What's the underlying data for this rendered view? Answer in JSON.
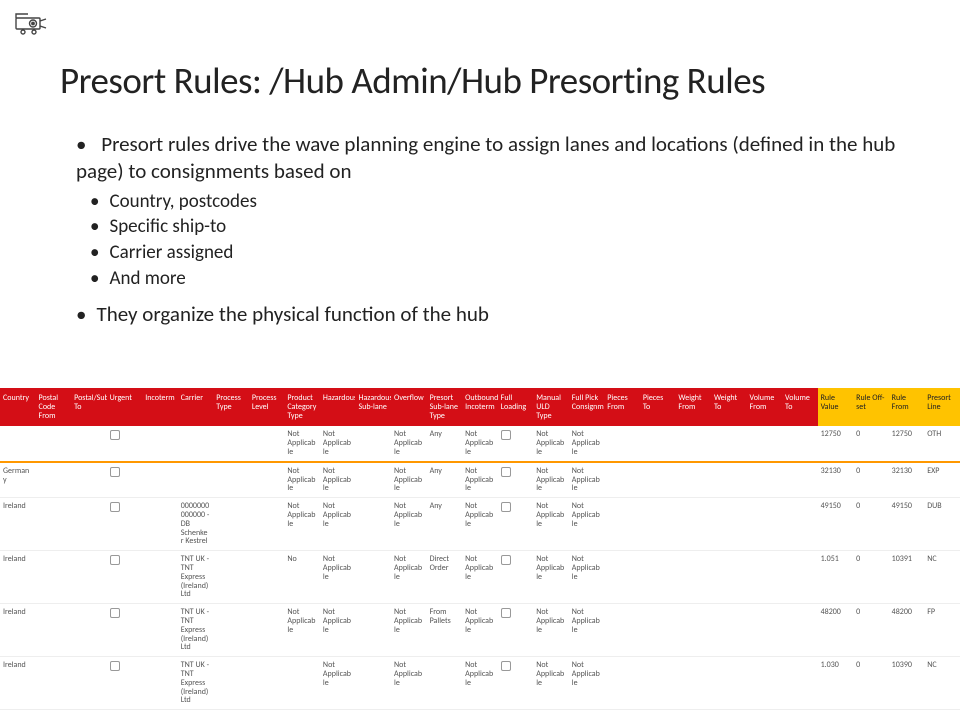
{
  "title": "Presort Rules: /Hub Admin/Hub Presorting Rules",
  "bullets": {
    "main1": "Presort rules drive the wave planning engine to assign lanes and locations (defined in the hub page) to consignments based on",
    "sub": [
      "Country, postcodes",
      "Specific ship-to",
      "Carrier assigned",
      "And more"
    ],
    "main2": "They organize the physical function of the hub"
  },
  "icon_name": "projector-icon",
  "table": {
    "headers": [
      "Country",
      "Postal Code From",
      "Postal/Sub To",
      "Urgent",
      "Incoterm",
      "Carrier",
      "Process Type",
      "Process Level",
      "Product Category Type",
      "Hazardous",
      "Hazardous Sub-lane",
      "Overflow",
      "Presort Sub-lane Type",
      "Outbound Incoterm",
      "Full Loading",
      "Manual ULD Type",
      "Full Pick Consignment",
      "Pieces From",
      "Pieces To",
      "Weight From",
      "Weight To",
      "Volume From",
      "Volume To",
      "Rule Value",
      "Rule Off-set",
      "Rule From",
      "Presort Line"
    ],
    "rows": [
      {
        "special": false,
        "cells": [
          "",
          "",
          "",
          "☐",
          "",
          "",
          "",
          "",
          "Not Applicable",
          "Not Applicable",
          "",
          "Not Applicable",
          "Any",
          "Not Applicable",
          "☐",
          "Not Applicable",
          "Not Applicable",
          "",
          "",
          "",
          "",
          "",
          "",
          "12750",
          "0",
          "12750",
          "OTH"
        ]
      },
      {
        "special": true,
        "cells": [
          "Germany",
          "",
          "",
          "☐",
          "",
          "",
          "",
          "",
          "Not Applicable",
          "Not Applicable",
          "",
          "Not Applicable",
          "Any",
          "Not Applicable",
          "☐",
          "Not Applicable",
          "Not Applicable",
          "",
          "",
          "",
          "",
          "",
          "",
          "32130",
          "0",
          "32130",
          "EXP"
        ]
      },
      {
        "special": false,
        "cells": [
          "Ireland",
          "",
          "",
          "☐",
          "",
          "0000000000000 - DB Schenker Kestrel",
          "",
          "",
          "Not Applicable",
          "Not Applicable",
          "",
          "Not Applicable",
          "Any",
          "Not Applicable",
          "☐",
          "Not Applicable",
          "Not Applicable",
          "",
          "",
          "",
          "",
          "",
          "",
          "49150",
          "0",
          "49150",
          "DUB"
        ]
      },
      {
        "special": false,
        "cells": [
          "Ireland",
          "",
          "",
          "☐",
          "",
          "TNT UK - TNT Express (Ireland) Ltd",
          "",
          "",
          "No",
          "Not Applicable",
          "",
          "Not Applicable",
          "Direct Order",
          "Not Applicable",
          "☐",
          "Not Applicable",
          "Not Applicable",
          "",
          "",
          "",
          "",
          "",
          "",
          "1.051",
          "0",
          "10391",
          "NC"
        ]
      },
      {
        "special": false,
        "cells": [
          "Ireland",
          "",
          "",
          "☐",
          "",
          "TNT UK - TNT Express (Ireland) Ltd",
          "",
          "",
          "Not Applicable",
          "Not Applicable",
          "",
          "Not Applicable",
          "From Pallets",
          "Not Applicable",
          "☐",
          "Not Applicable",
          "Not Applicable",
          "",
          "",
          "",
          "",
          "",
          "",
          "48200",
          "0",
          "48200",
          "FP"
        ]
      },
      {
        "special": false,
        "cells": [
          "Ireland",
          "",
          "",
          "☐",
          "",
          "TNT UK - TNT Express (Ireland) Ltd",
          "",
          "",
          "",
          "Not Applicable",
          "",
          "Not Applicable",
          "",
          "Not Applicable",
          "☐",
          "Not Applicable",
          "Not Applicable",
          "",
          "",
          "",
          "",
          "",
          "",
          "1.030",
          "0",
          "10390",
          "NC"
        ]
      }
    ]
  }
}
